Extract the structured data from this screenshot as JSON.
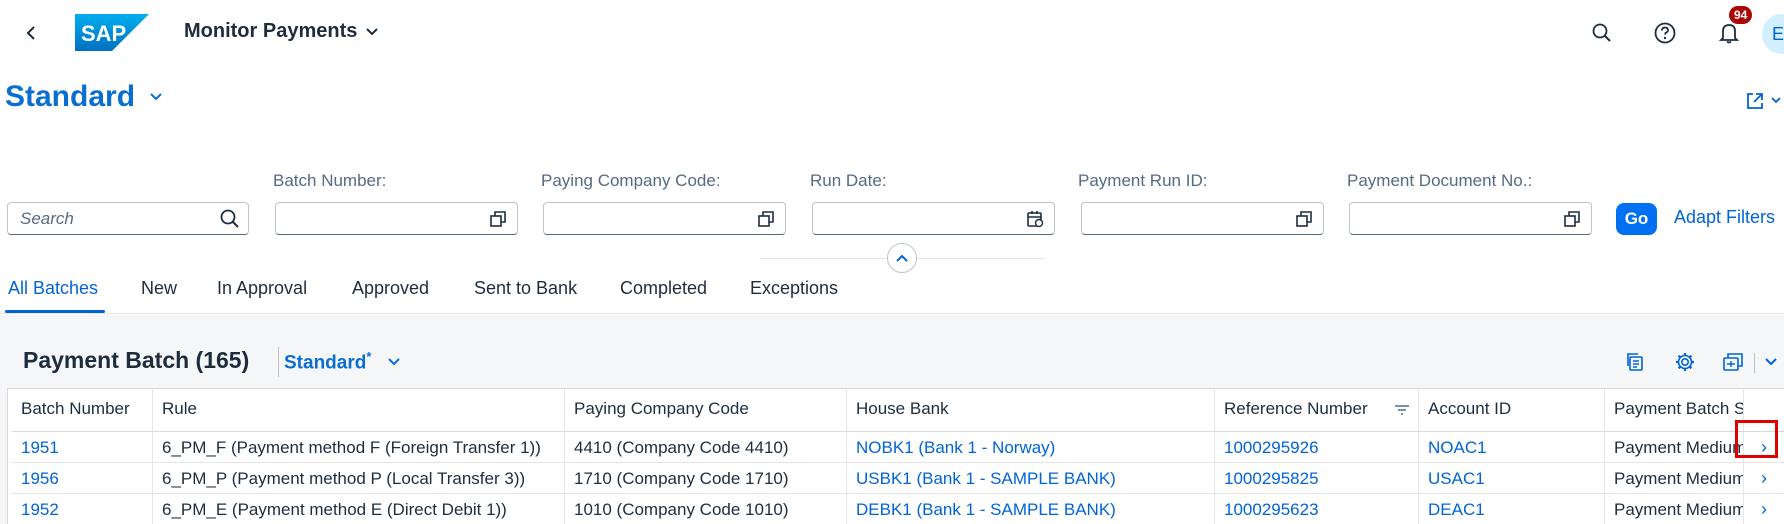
{
  "shell": {
    "app_title": "Monitor Payments",
    "notification_count": "94",
    "avatar_initial": "E"
  },
  "variant": {
    "title": "Standard"
  },
  "filters": {
    "search_placeholder": "Search",
    "fields": [
      {
        "label": "Batch Number:"
      },
      {
        "label": "Paying Company Code:"
      },
      {
        "label": "Run Date:"
      },
      {
        "label": "Payment Run ID:"
      },
      {
        "label": "Payment Document No.:"
      }
    ],
    "go_label": "Go",
    "adapt_label": "Adapt Filters"
  },
  "tabs": [
    "All Batches",
    "New",
    "In Approval",
    "Approved",
    "Sent to Bank",
    "Completed",
    "Exceptions"
  ],
  "table": {
    "title": "Payment Batch (165)",
    "variant": "Standard",
    "variant_modified": "*",
    "columns": [
      "Batch Number",
      "Rule",
      "Paying Company Code",
      "House Bank",
      "Reference Number",
      "Account ID",
      "Payment Batch S"
    ],
    "rows": [
      [
        "1951",
        "6_PM_F (Payment method F (Foreign Transfer 1))",
        "4410 (Company Code 4410)",
        "NOBK1 (Bank 1 - Norway)",
        "1000295926",
        "NOAC1",
        "Payment Medium"
      ],
      [
        "1956",
        "6_PM_P (Payment method P (Local Transfer 3))",
        "1710 (Company Code 1710)",
        "USBK1 (Bank 1 - SAMPLE BANK)",
        "1000295825",
        "USAC1",
        "Payment Medium"
      ],
      [
        "1952",
        "6_PM_E (Payment method E (Direct Debit 1))",
        "1010 (Company Code 1010)",
        "DEBK1 (Bank 1 - SAMPLE BANK)",
        "1000295623",
        "DEAC1",
        "Payment Medium"
      ]
    ]
  },
  "colors": {
    "accent": "#0064d9",
    "go_button": "#0070f2",
    "badge": "#aa0808",
    "highlight": "#e00000"
  }
}
